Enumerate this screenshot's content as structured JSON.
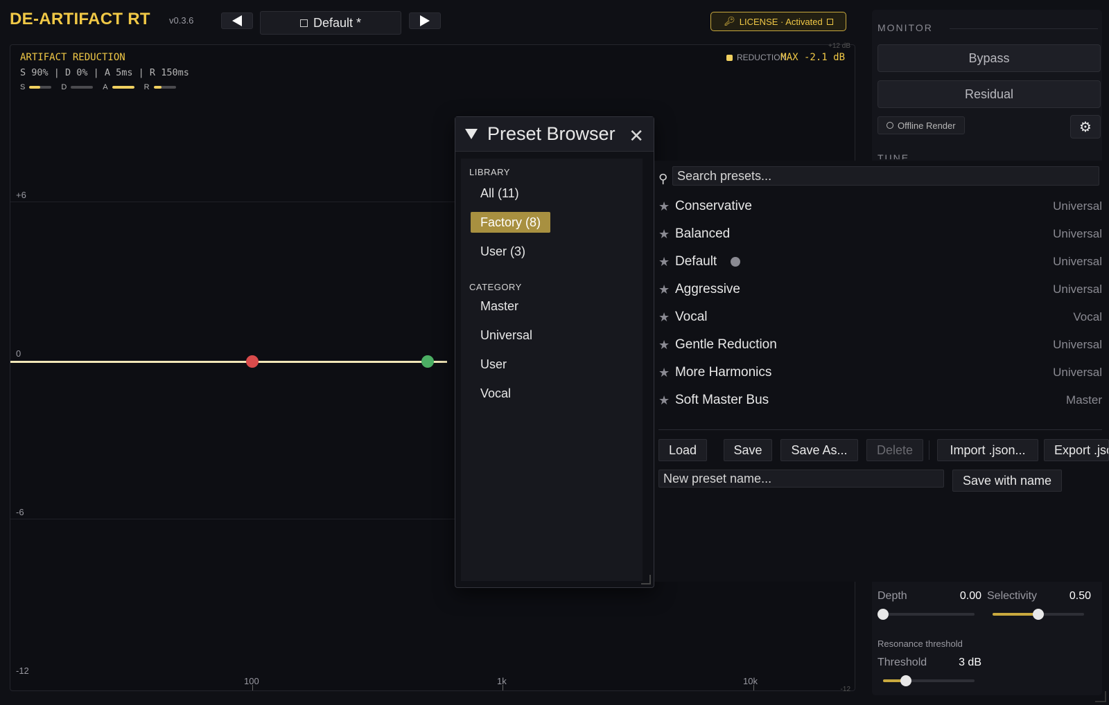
{
  "header": {
    "app_title": "DE-ARTIFACT RT",
    "version": "v0.3.6",
    "preset_name": "Default *",
    "license": "LICENSE · Activated"
  },
  "plot": {
    "title": "ARTIFACT REDUCTION",
    "params": "S 90% | D 0% | A 5ms | R 150ms",
    "mini_bars": [
      {
        "label": "S",
        "level": 0.5
      },
      {
        "label": "D",
        "level": 0.0
      },
      {
        "label": "A",
        "level": 1.0
      },
      {
        "label": "R",
        "level": 0.35
      }
    ],
    "legend_label": "REDUCTION",
    "max_readout": "MAX -2.1 dB",
    "top_right_tiny": "+12 dB",
    "y_labels": {
      "plus6": "+6",
      "zero": "0",
      "minus6": "-6",
      "minus12": "-12"
    },
    "x_labels": {
      "x100": "100",
      "x1k": "1k",
      "x10k": "10k"
    },
    "bottom_right_tiny": "-12",
    "colors": {
      "curve": "#f2e7b8",
      "node_low": "#d94b4b",
      "node_mid": "#4caf64",
      "accent": "#f0c846"
    }
  },
  "monitor": {
    "header": "MONITOR",
    "bypass": "Bypass",
    "residual": "Residual",
    "offline_render": "Offline Render",
    "tune_header": "TUNE"
  },
  "tune": {
    "depth_label": "Depth",
    "depth_value": "0.00",
    "depth_level": 0.0,
    "selectivity_label": "Selectivity",
    "selectivity_value": "0.50",
    "selectivity_level": 0.5,
    "resonance_header": "Resonance threshold",
    "threshold_label": "Threshold",
    "threshold_value": "3 dB",
    "threshold_level": 0.25
  },
  "preset_browser": {
    "title": "Preset Browser",
    "library_header": "LIBRARY",
    "library": [
      "All (11)",
      "Factory (8)",
      "User (3)"
    ],
    "category_header": "CATEGORY",
    "categories": [
      "Master",
      "Universal",
      "User",
      "Vocal"
    ],
    "search_placeholder": "Search presets...",
    "presets": [
      {
        "name": "Conservative",
        "category": "Universal"
      },
      {
        "name": "Balanced",
        "category": "Universal"
      },
      {
        "name": "Default",
        "category": "Universal"
      },
      {
        "name": "Aggressive",
        "category": "Universal"
      },
      {
        "name": "Vocal",
        "category": "Vocal"
      },
      {
        "name": "Gentle Reduction",
        "category": "Universal"
      },
      {
        "name": "More Harmonics",
        "category": "Universal"
      },
      {
        "name": "Soft Master Bus",
        "category": "Master"
      }
    ],
    "actions": {
      "load": "Load",
      "save": "Save",
      "save_as": "Save As...",
      "delete": "Delete",
      "import": "Import .json...",
      "export": "Export .json..."
    },
    "name_placeholder": "New preset name...",
    "save_with_name": "Save with name"
  }
}
